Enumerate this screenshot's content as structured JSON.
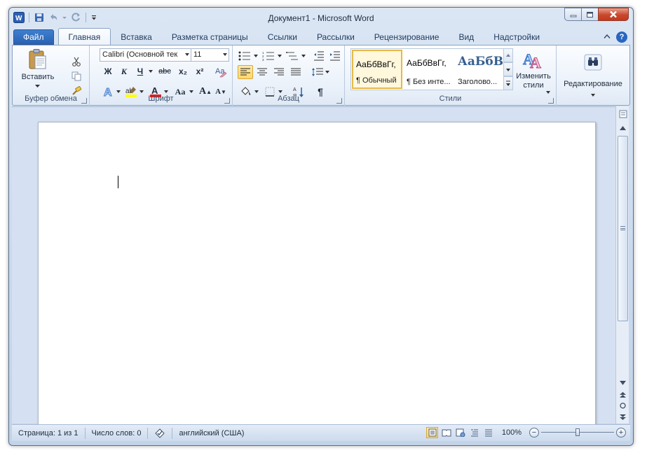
{
  "window": {
    "title": "Документ1  -  Microsoft Word"
  },
  "quick_access": {
    "app_icon": "word-icon",
    "items": [
      "save-icon",
      "undo-icon",
      "redo-icon",
      "customize-qat-icon"
    ]
  },
  "tabs": [
    {
      "label": "Файл",
      "kind": "file"
    },
    {
      "label": "Главная",
      "active": true
    },
    {
      "label": "Вставка"
    },
    {
      "label": "Разметка страницы"
    },
    {
      "label": "Ссылки"
    },
    {
      "label": "Рассылки"
    },
    {
      "label": "Рецензирование"
    },
    {
      "label": "Вид"
    },
    {
      "label": "Надстройки"
    }
  ],
  "ribbon": {
    "clipboard": {
      "group_label": "Буфер обмена",
      "paste_label": "Вставить"
    },
    "font": {
      "group_label": "Шрифт",
      "font_name": "Calibri (Основной тек",
      "font_size": "11",
      "bold": "Ж",
      "italic": "К",
      "underline": "Ч",
      "strike": "abc",
      "subscript": "x₂",
      "superscript": "x²",
      "grow": "A",
      "shrink": "A",
      "change_case": "Aa",
      "font_color_letter": "A",
      "text_effects_letter": "A",
      "highlight_letter": "ab"
    },
    "paragraph": {
      "group_label": "Абзац",
      "pilcrow": "¶"
    },
    "styles": {
      "group_label": "Стили",
      "items": [
        {
          "sample": "АаБбВвГг,",
          "name": "¶ Обычный",
          "selected": true
        },
        {
          "sample": "АаБбВвГг,",
          "name": "¶ Без инте..."
        },
        {
          "sample": "АаБбВ",
          "name": "Заголово..."
        }
      ],
      "change_styles_label": "Изменить стили"
    },
    "editing": {
      "label": "Редактирование"
    }
  },
  "status": {
    "page": "Страница: 1 из 1",
    "words": "Число слов: 0",
    "language": "английский (США)",
    "zoom": "100%",
    "zoom_level": 0.5
  },
  "colors": {
    "accent": "#2a62b2",
    "font_color": "#e02020",
    "highlight": "#ffff00",
    "close_button": "#c9482d"
  }
}
